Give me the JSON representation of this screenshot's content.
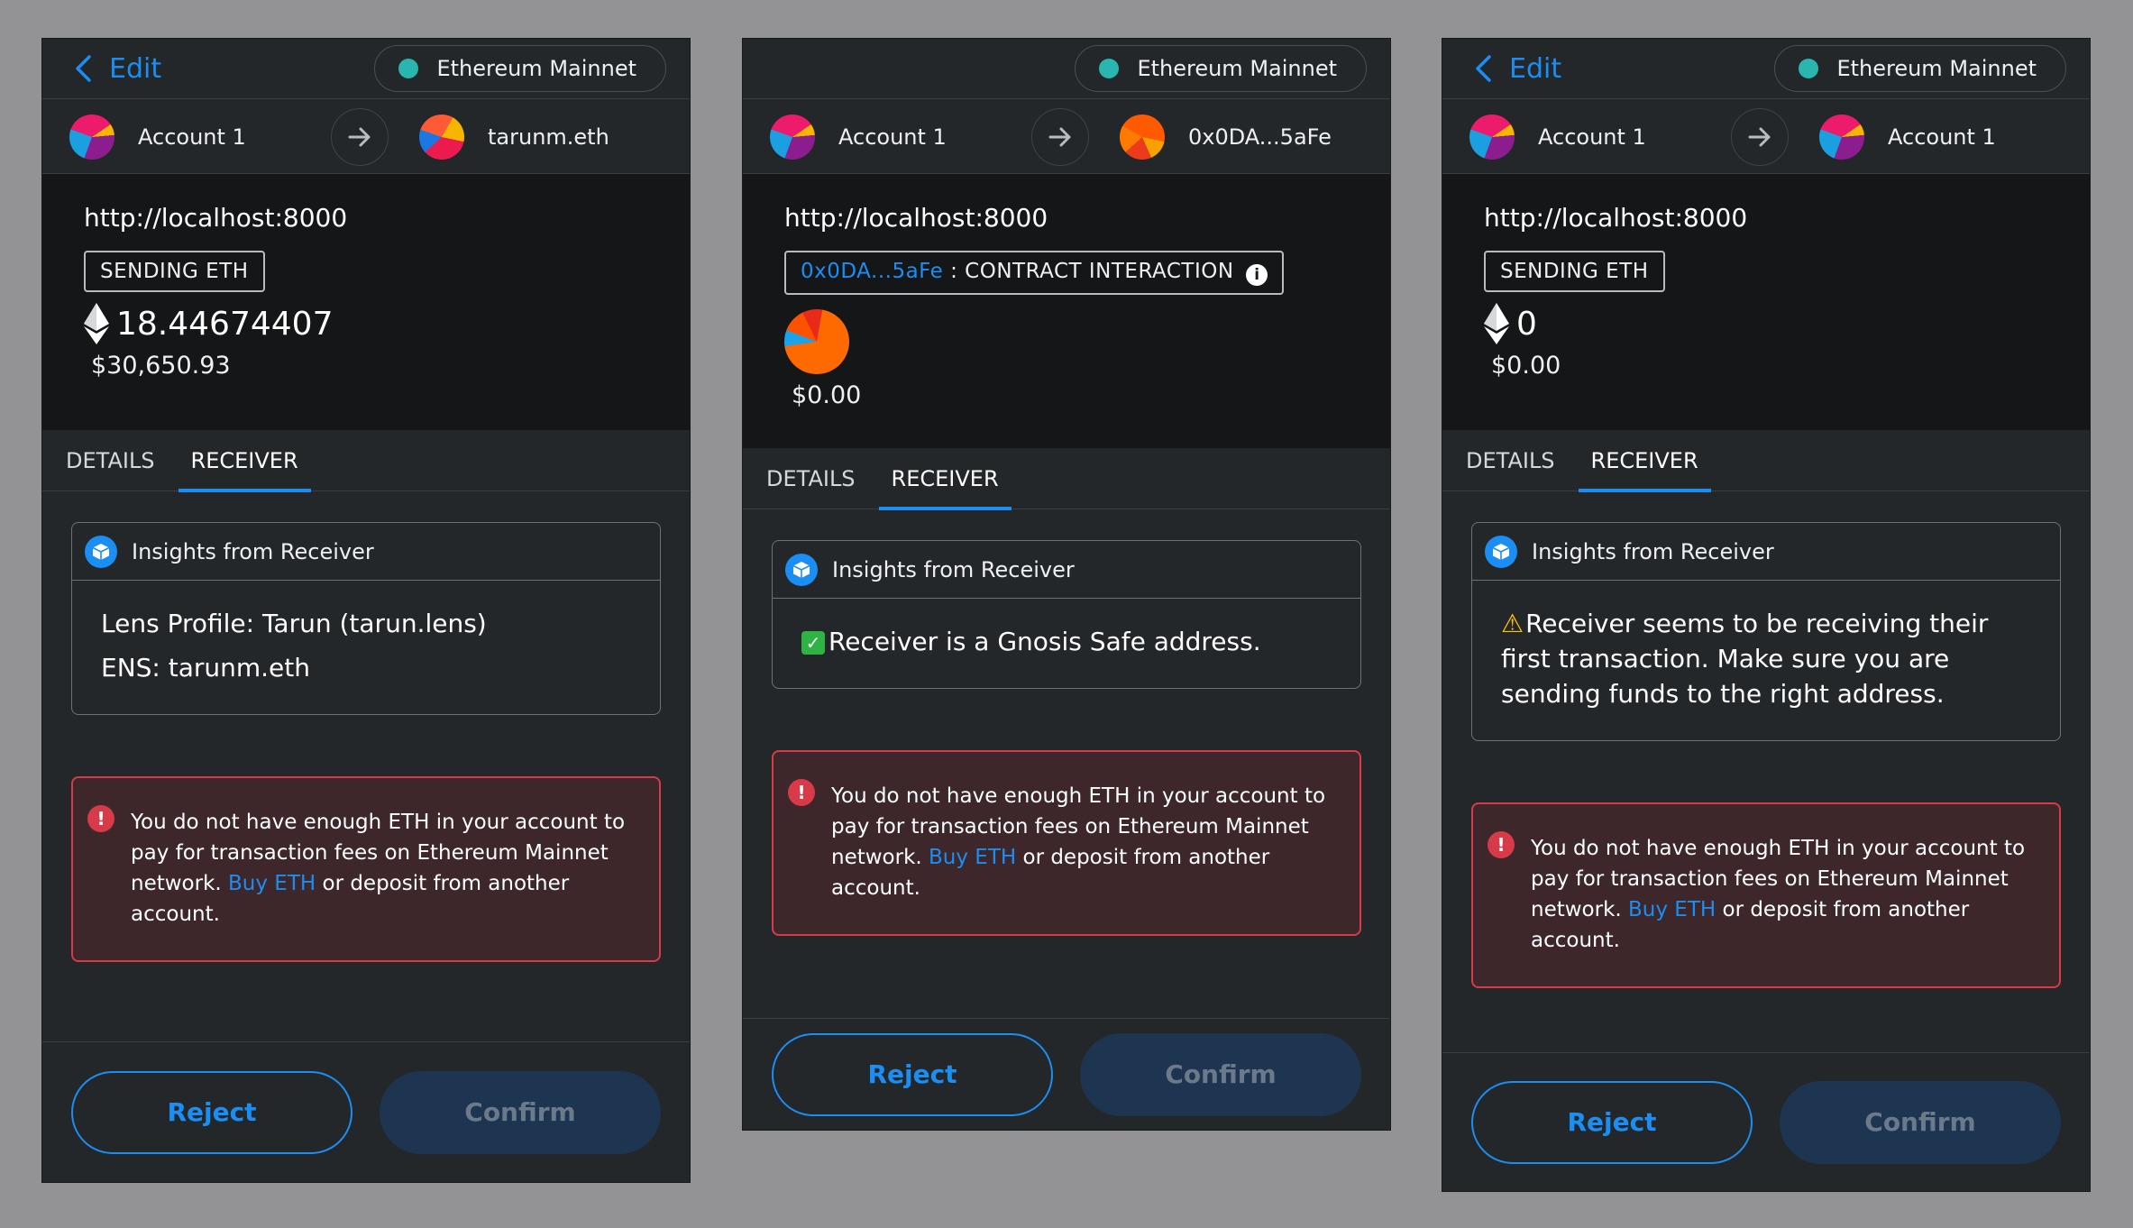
{
  "panels": [
    {
      "edit_label": "Edit",
      "network": "Ethereum Mainnet",
      "from_account": "Account 1",
      "to_account": "tarunm.eth",
      "origin": "http://localhost:8000",
      "tag": "SENDING ETH",
      "amount": "18.44674407",
      "fiat": "$30,650.93",
      "tabs": [
        "DETAILS",
        "RECEIVER"
      ],
      "insights_title": "Insights from Receiver",
      "insights": [
        "Lens Profile: Tarun (tarun.lens)",
        "ENS: tarunm.eth"
      ],
      "error": {
        "before": "You do not have enough ETH in your account to pay for transaction fees on Ethereum Mainnet network. ",
        "link": "Buy ETH",
        "after": " or deposit from another account."
      },
      "reject": "Reject",
      "confirm": "Confirm"
    },
    {
      "network": "Ethereum Mainnet",
      "from_account": "Account 1",
      "to_account": "0x0DA...5aFe",
      "origin": "http://localhost:8000",
      "tag_address": "0x0DA...5aFe",
      "tag_rest": " : CONTRACT INTERACTION",
      "fiat": "$0.00",
      "tabs": [
        "DETAILS",
        "RECEIVER"
      ],
      "insights_title": "Insights from Receiver",
      "insight_check": "✓",
      "insight": "Receiver is a Gnosis Safe address.",
      "error": {
        "before": "You do not have enough ETH in your account to pay for transaction fees on Ethereum Mainnet network. ",
        "link": "Buy ETH",
        "after": " or deposit from another account."
      },
      "reject": "Reject",
      "confirm": "Confirm"
    },
    {
      "edit_label": "Edit",
      "network": "Ethereum Mainnet",
      "from_account": "Account 1",
      "to_account": "Account 1",
      "origin": "http://localhost:8000",
      "tag": "SENDING ETH",
      "amount": "0",
      "fiat": "$0.00",
      "tabs": [
        "DETAILS",
        "RECEIVER"
      ],
      "insights_title": "Insights from Receiver",
      "insight_warn": "⚠",
      "insight": "Receiver seems to be receiving their first transaction. Make sure you are sending funds to the right address.",
      "error": {
        "before": "You do not have enough ETH in your account to pay for transaction fees on Ethereum Mainnet network. ",
        "link": "Buy ETH",
        "after": " or deposit from another account."
      },
      "reject": "Reject",
      "confirm": "Confirm"
    }
  ],
  "icons": {
    "info": "i",
    "error": "!"
  },
  "colors": {
    "accent": "#1b8ef3",
    "error": "#d73a49",
    "network_dot": "#29b6af"
  }
}
